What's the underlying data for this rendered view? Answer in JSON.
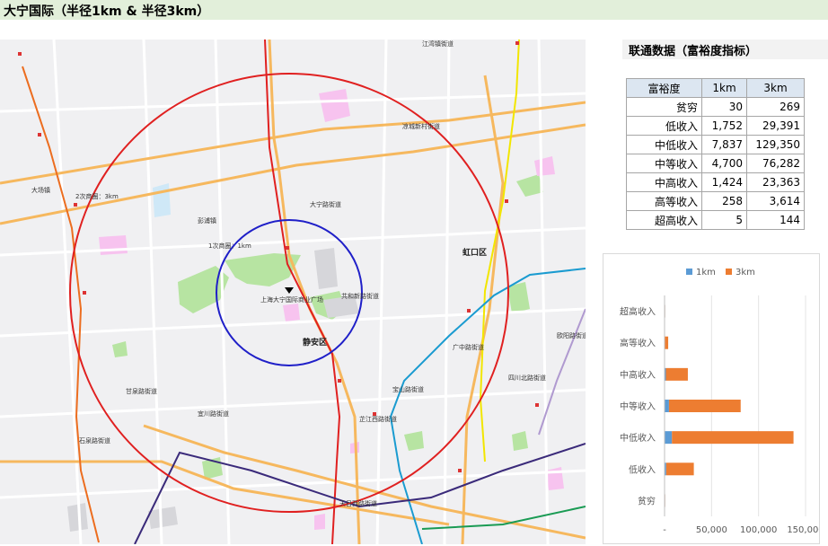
{
  "header": {
    "title": "大宁国际（半径1km & 半径3km）"
  },
  "map": {
    "labels": {
      "jiangwan": "江湾镇街道",
      "liangcheng": "凉城新村街道",
      "dachang": "大场镇",
      "ring2": "2次商圈：3km",
      "pengpu": "彭浦镇",
      "daning_st": "大宁路街道",
      "ring1": "1次商圈：1km",
      "hongkou": "虹口区",
      "plaza": "上海大宁国际商业广场",
      "gonghexin": "共和新路街道",
      "jingan": "静安区",
      "guangzhong": "广中路街道",
      "ouyang": "欧阳路街道",
      "sichuanbei": "四川北路街道",
      "baoshan": "宝山路街道",
      "ganquan": "甘泉路街道",
      "yichuan": "宜川路街道",
      "zhijiang": "芷江西路街道",
      "shiquan": "石泉路街道",
      "tianmu": "天目西路街道"
    },
    "colors": {
      "ring_1km": "#1f1fc8",
      "ring_3km": "#e02020",
      "park": "#b7e4a2",
      "campus": "#f7c3ef"
    }
  },
  "panel": {
    "title": "联通数据（富裕度指标）",
    "table": {
      "headers": [
        "富裕度",
        "1km",
        "3km"
      ],
      "rows": [
        [
          "贫穷",
          "30",
          "269"
        ],
        [
          "低收入",
          "1,752",
          "29,391"
        ],
        [
          "中低收入",
          "7,837",
          "129,350"
        ],
        [
          "中等收入",
          "4,700",
          "76,282"
        ],
        [
          "中高收入",
          "1,424",
          "23,363"
        ],
        [
          "高等收入",
          "258",
          "3,614"
        ],
        [
          "超高收入",
          "5",
          "144"
        ]
      ]
    }
  },
  "chart_data": {
    "type": "bar",
    "orientation": "horizontal",
    "stacked": true,
    "categories": [
      "贫穷",
      "低收入",
      "中低收入",
      "中等收入",
      "中高收入",
      "高等收入",
      "超高收入"
    ],
    "series": [
      {
        "name": "1km",
        "values": [
          30,
          1752,
          7837,
          4700,
          1424,
          258,
          5
        ],
        "color": "#5b9bd5"
      },
      {
        "name": "3km",
        "values": [
          269,
          29391,
          129350,
          76282,
          23363,
          3614,
          144
        ],
        "color": "#ed7d31"
      }
    ],
    "xlim": [
      0,
      150000
    ],
    "xticks": [
      "-",
      "50,000",
      "100,000",
      "150,000"
    ],
    "legend": "top",
    "grid": true
  }
}
